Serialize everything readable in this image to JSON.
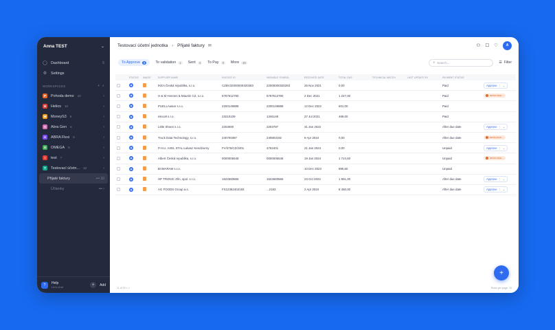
{
  "sidebar": {
    "user_name": "Anna TEST",
    "nav": [
      {
        "label": "Dashboard",
        "count": "5"
      },
      {
        "label": "Settings",
        "count": ""
      }
    ],
    "section_label": "WORKSPACES",
    "workspaces": [
      {
        "label": "Pohoda demo",
        "count": "10",
        "color": "#e86a2a",
        "letter": "P"
      },
      {
        "label": "Helios",
        "count": "10",
        "color": "#e2403a",
        "letter": "H"
      },
      {
        "label": "MoneyS3",
        "count": "5",
        "color": "#f0a020",
        "letter": "M"
      },
      {
        "label": "Abra Gen",
        "count": "6",
        "color": "#d86fb9",
        "letter": "A"
      },
      {
        "label": "ABRA Flexi",
        "count": "6",
        "color": "#7b4ef0",
        "letter": "A"
      },
      {
        "label": "OMEGA",
        "count": "6",
        "color": "#3fae5a",
        "letter": "O"
      },
      {
        "label": "test",
        "count": "7",
        "color": "#e2403a",
        "letter": "t"
      },
      {
        "label": "Testovací účetn...",
        "count": "10",
        "color": "#1aa58a",
        "letter": "T"
      }
    ],
    "active_item": {
      "label": "Přijaté faktury",
      "count": "10"
    },
    "sub_item": {
      "label": "Účtenky"
    },
    "help": {
      "label": "Help",
      "sub": "Let's chat"
    },
    "add_label": "Add"
  },
  "header": {
    "workspace": "Testovací účetní jednotka",
    "page": "Přijaté faktury",
    "avatar_letter": "A"
  },
  "tabs": [
    {
      "label": "To Approve",
      "count": "8",
      "active": true
    },
    {
      "label": "To validation",
      "count": "1"
    },
    {
      "label": "Sent",
      "count": "4"
    },
    {
      "label": "To Pay",
      "count": "0"
    },
    {
      "label": "More",
      "count": "20"
    }
  ],
  "search": {
    "placeholder": "Search..."
  },
  "filter_label": "Filter",
  "table": {
    "headers": [
      "STATUS",
      "IMAGE",
      "SUPPLIER NAME",
      "INVOICE ID",
      "VARIABLE SYMBOL",
      "RECEIVED DATE",
      "TOTAL DUE",
      "TECHNICAL MATCH",
      "LAST UPDATE BY",
      "PAYMENT STATUS",
      ""
    ],
    "rows": [
      {
        "supplier": "IKEA Česká republika, s.r.o.",
        "invoice": "CZBV32000000320283",
        "variable": "22000000320283",
        "date": "26 Nov 2021",
        "total": "0,00",
        "payment": "Paid",
        "action": "approve"
      },
      {
        "supplier": "H & M Hennes & Mauritz CZ, s.r.o.",
        "invoice": "5787612780",
        "variable": "5787612780",
        "date": "2 Dec 2021",
        "total": "1 247,00",
        "payment": "Paid",
        "action": "user",
        "user": "anna.rosa..."
      },
      {
        "supplier": "PUELLAwear s.r.o.",
        "invoice": "2200149888",
        "variable": "2200149888",
        "date": "12 Dec 2022",
        "total": "601,00",
        "payment": "Paid",
        "action": "none"
      },
      {
        "supplier": "eleco8 s.r.o.",
        "invoice": "23210109",
        "variable": "1346148",
        "date": "27 Jul 2021",
        "total": "469,00",
        "payment": "Paid",
        "action": "none"
      },
      {
        "supplier": "Little Shoes s.r.o.",
        "invoice": "2203000",
        "variable": "2203787",
        "date": "31 Jan 2022",
        "total": "",
        "payment": "After due date",
        "action": "approve"
      },
      {
        "supplier": "Truck Data Technology, s.r.o.",
        "invoice": "240700387",
        "variable": "240803192",
        "date": "9 Apr 2024",
        "total": "0,00",
        "payment": "After due date",
        "action": "user",
        "user": "anna.plus..."
      },
      {
        "supplier": "P.H.U. AXEL STAL Łukasz Kendziorny",
        "invoice": "FV/476/CZ/2401",
        "variable": "4762401",
        "date": "21 Jan 2024",
        "total": "0,00",
        "payment": "Unpaid",
        "action": "approve"
      },
      {
        "supplier": "Albert Česká republika, s.r.o.",
        "invoice": "0000006548",
        "variable": "0000006548",
        "date": "19 Jan 2024",
        "total": "1 724,60",
        "payment": "Unpaid",
        "action": "user",
        "user": "anna.rosa..."
      },
      {
        "supplier": "BAMARAM s.r.o.",
        "invoice": "",
        "variable": "",
        "date": "10 Dec 2023",
        "total": "895,60",
        "payment": "Unpaid",
        "action": "none"
      },
      {
        "supplier": "HP TRONIC Zlín, spol. s r.o.",
        "invoice": "1622683566",
        "variable": "1622683566",
        "date": "23 Oct 2022",
        "total": "1 951,00",
        "payment": "After due date",
        "action": "approve"
      },
      {
        "supplier": "AG FOODS Group a.s.",
        "invoice": "FS12362402183",
        "variable": "...2183",
        "date": "2 Apr 2024",
        "total": "8 450,00",
        "payment": "After due date",
        "action": "approve"
      }
    ],
    "approve_label": "Approve"
  },
  "footer": {
    "left": "11 of 20 < >",
    "right": "Rows per page: 10"
  },
  "fab_label": "+"
}
